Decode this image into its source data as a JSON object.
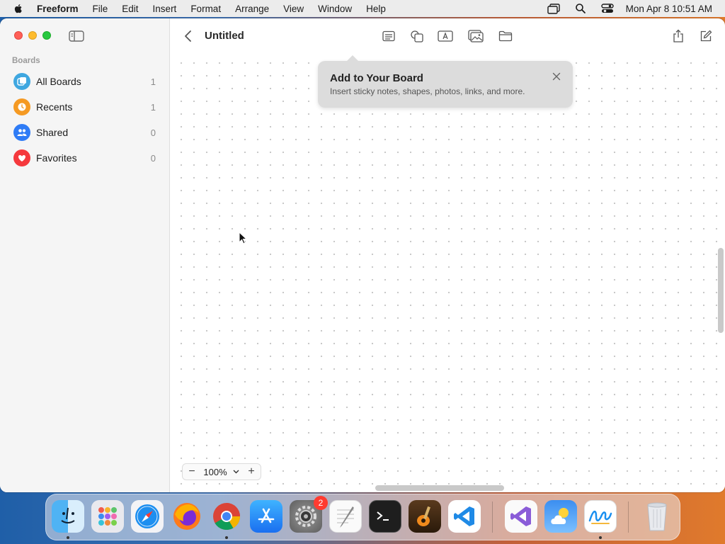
{
  "menubar": {
    "app_name": "Freeform",
    "items": [
      "File",
      "Edit",
      "Insert",
      "Format",
      "Arrange",
      "View",
      "Window",
      "Help"
    ],
    "clock": "Mon Apr 8  10:51 AM",
    "status_icons": [
      "window-switcher-icon",
      "search-icon",
      "control-center-icon"
    ]
  },
  "sidebar": {
    "section_label": "Boards",
    "items": [
      {
        "label": "All Boards",
        "count": "1",
        "icon": "all-boards-icon",
        "color": "#3fa7e0"
      },
      {
        "label": "Recents",
        "count": "1",
        "icon": "clock-icon",
        "color": "#f59a23"
      },
      {
        "label": "Shared",
        "count": "0",
        "icon": "people-icon",
        "color": "#2f7cf6"
      },
      {
        "label": "Favorites",
        "count": "0",
        "icon": "heart-icon",
        "color": "#f5393d"
      }
    ]
  },
  "toolbar": {
    "title": "Untitled",
    "tools": [
      "sticky-note-icon",
      "shapes-icon",
      "text-box-icon",
      "media-icon",
      "folder-icon",
      "share-icon",
      "compose-icon"
    ]
  },
  "tip": {
    "title": "Add to Your Board",
    "body": "Insert sticky notes, shapes, photos, links, and more."
  },
  "zoom": {
    "value": "100%",
    "minus": "−",
    "plus": "+"
  },
  "dock": {
    "apps": [
      "Finder",
      "Launchpad",
      "Safari",
      "Firefox",
      "Chrome",
      "App Store",
      "System Settings",
      "TextEdit",
      "Terminal",
      "GarageBand",
      "VS Code",
      "Visual Studio",
      "Weather",
      "Freeform",
      "Trash"
    ],
    "settings_badge": "2"
  },
  "colors": {
    "accent": "#2f7cf6",
    "canvas_dots": "#c6c6c6"
  }
}
